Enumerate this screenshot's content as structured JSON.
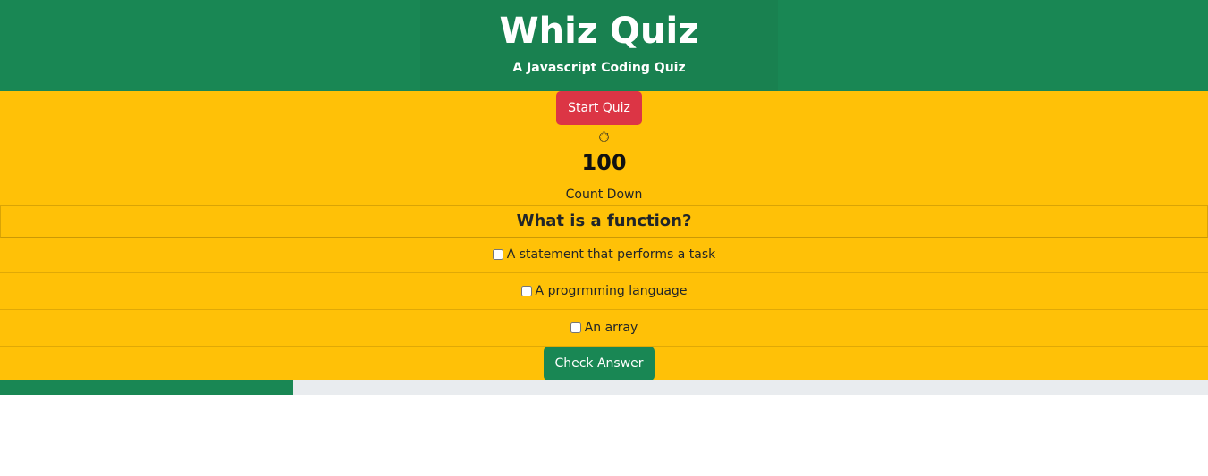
{
  "header": {
    "title": "Whiz Quiz",
    "subtitle": "A Javascript Coding Quiz"
  },
  "controls": {
    "start_label": "Start Quiz",
    "timer_icon": "⏱",
    "timer_icon_name": "stopwatch-icon",
    "count": "100",
    "count_label": "Count Down"
  },
  "quiz": {
    "question": "What is a function?",
    "answers": [
      {
        "label": "A statement that performs a task",
        "checked": false
      },
      {
        "label": "A progrmming language",
        "checked": false
      },
      {
        "label": "An array",
        "checked": false
      }
    ],
    "check_label": "Check Answer"
  },
  "progress": {
    "fraction": 0.243
  },
  "colors": {
    "header_bg": "#198754",
    "main_bg": "#ffc107",
    "start_button": "#dc3545",
    "check_button": "#198754",
    "progress_fill": "#198754",
    "progress_track": "#e9ecef"
  }
}
